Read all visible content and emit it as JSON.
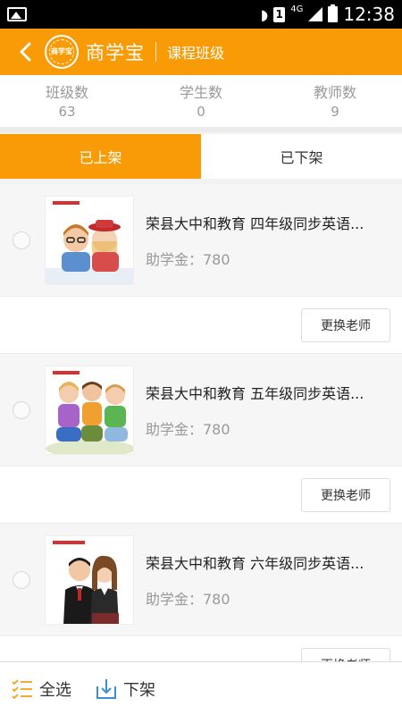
{
  "status_bar": {
    "network": "4G",
    "sim": "1",
    "time": "12:38"
  },
  "header": {
    "brand": "商学宝",
    "title": "课程班级",
    "logo_text": "商学宝"
  },
  "stats": [
    {
      "label": "班级数",
      "value": "63"
    },
    {
      "label": "学生数",
      "value": "0"
    },
    {
      "label": "教师数",
      "value": "9"
    }
  ],
  "tabs": [
    {
      "label": "已上架",
      "active": true
    },
    {
      "label": "已下架",
      "active": false
    }
  ],
  "courses": [
    {
      "title": "荣县大中和教育 四年级同步英语...",
      "grant": "助学金：780",
      "button": "更换老师"
    },
    {
      "title": "荣县大中和教育 五年级同步英语...",
      "grant": "助学金：780",
      "button": "更换老师"
    },
    {
      "title": "荣县大中和教育 六年级同步英语...",
      "grant": "助学金：780",
      "button": "更换老师"
    }
  ],
  "bottom_bar": {
    "select_all": "全选",
    "unshelve": "下架"
  },
  "colors": {
    "accent": "#f99b06",
    "muted_text": "#999999"
  }
}
